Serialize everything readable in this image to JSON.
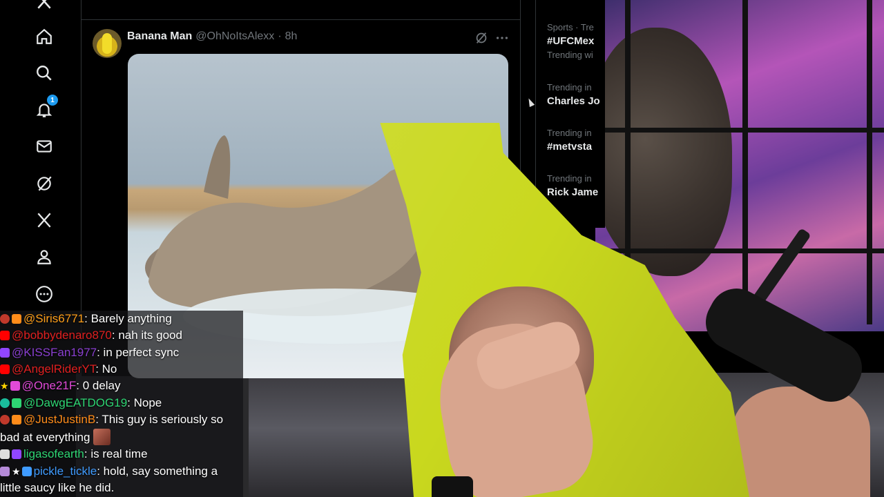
{
  "nav": {
    "items": [
      {
        "name": "home"
      },
      {
        "name": "explore"
      },
      {
        "name": "notifications",
        "badge": "1"
      },
      {
        "name": "messages"
      },
      {
        "name": "grok"
      },
      {
        "name": "premium"
      },
      {
        "name": "profile"
      },
      {
        "name": "more"
      }
    ]
  },
  "post": {
    "display_name": "Banana Man",
    "handle": "@OhNoItsAlexx",
    "dot": "·",
    "time": "8h"
  },
  "trends": [
    {
      "meta": "Sports · Tre",
      "title": "#UFCMex",
      "sub": "Trending wi"
    },
    {
      "meta": "Trending in",
      "title": "Charles Jo"
    },
    {
      "meta": "Trending in",
      "title": "#metvsta"
    },
    {
      "meta": "Trending in",
      "title": "Rick Jame"
    }
  ],
  "chat": [
    {
      "platform": "youtube",
      "user": "@Siris6771",
      "user_color": "#ff9f1a",
      "message": ": Barely anything"
    },
    {
      "platform": "youtube",
      "user": "@bobbydenaro870",
      "user_color": "#e02020",
      "message": ": nah its good"
    },
    {
      "platform": "youtube",
      "user": "@KISSFan1977",
      "user_color": "#8a3fd0",
      "message": ": in perfect sync"
    },
    {
      "platform": "youtube",
      "user": "@AngelRiderYT",
      "user_color": "#e02020",
      "message": ": No"
    },
    {
      "platform": "youtube",
      "user": "@One21F",
      "user_color": "#e04ad8",
      "message": ": 0 delay"
    },
    {
      "platform": "youtube",
      "user": "@DawgEATDOG19",
      "user_color": "#2ed573",
      "message": ": Nope"
    },
    {
      "platform": "youtube",
      "user": "@JustJustinB",
      "user_color": "#ff8c1a",
      "message": ": This guy is seriously so",
      "message2": "bad at everything"
    },
    {
      "platform": "twitch",
      "user": "ligasofearth",
      "user_color": "#2ed573",
      "message": ": is real time"
    },
    {
      "platform": "twitch",
      "user": "pickle_tickle",
      "user_color": "#3f9bff",
      "message": ": hold, say something a",
      "message2": "little saucy like he did."
    }
  ]
}
